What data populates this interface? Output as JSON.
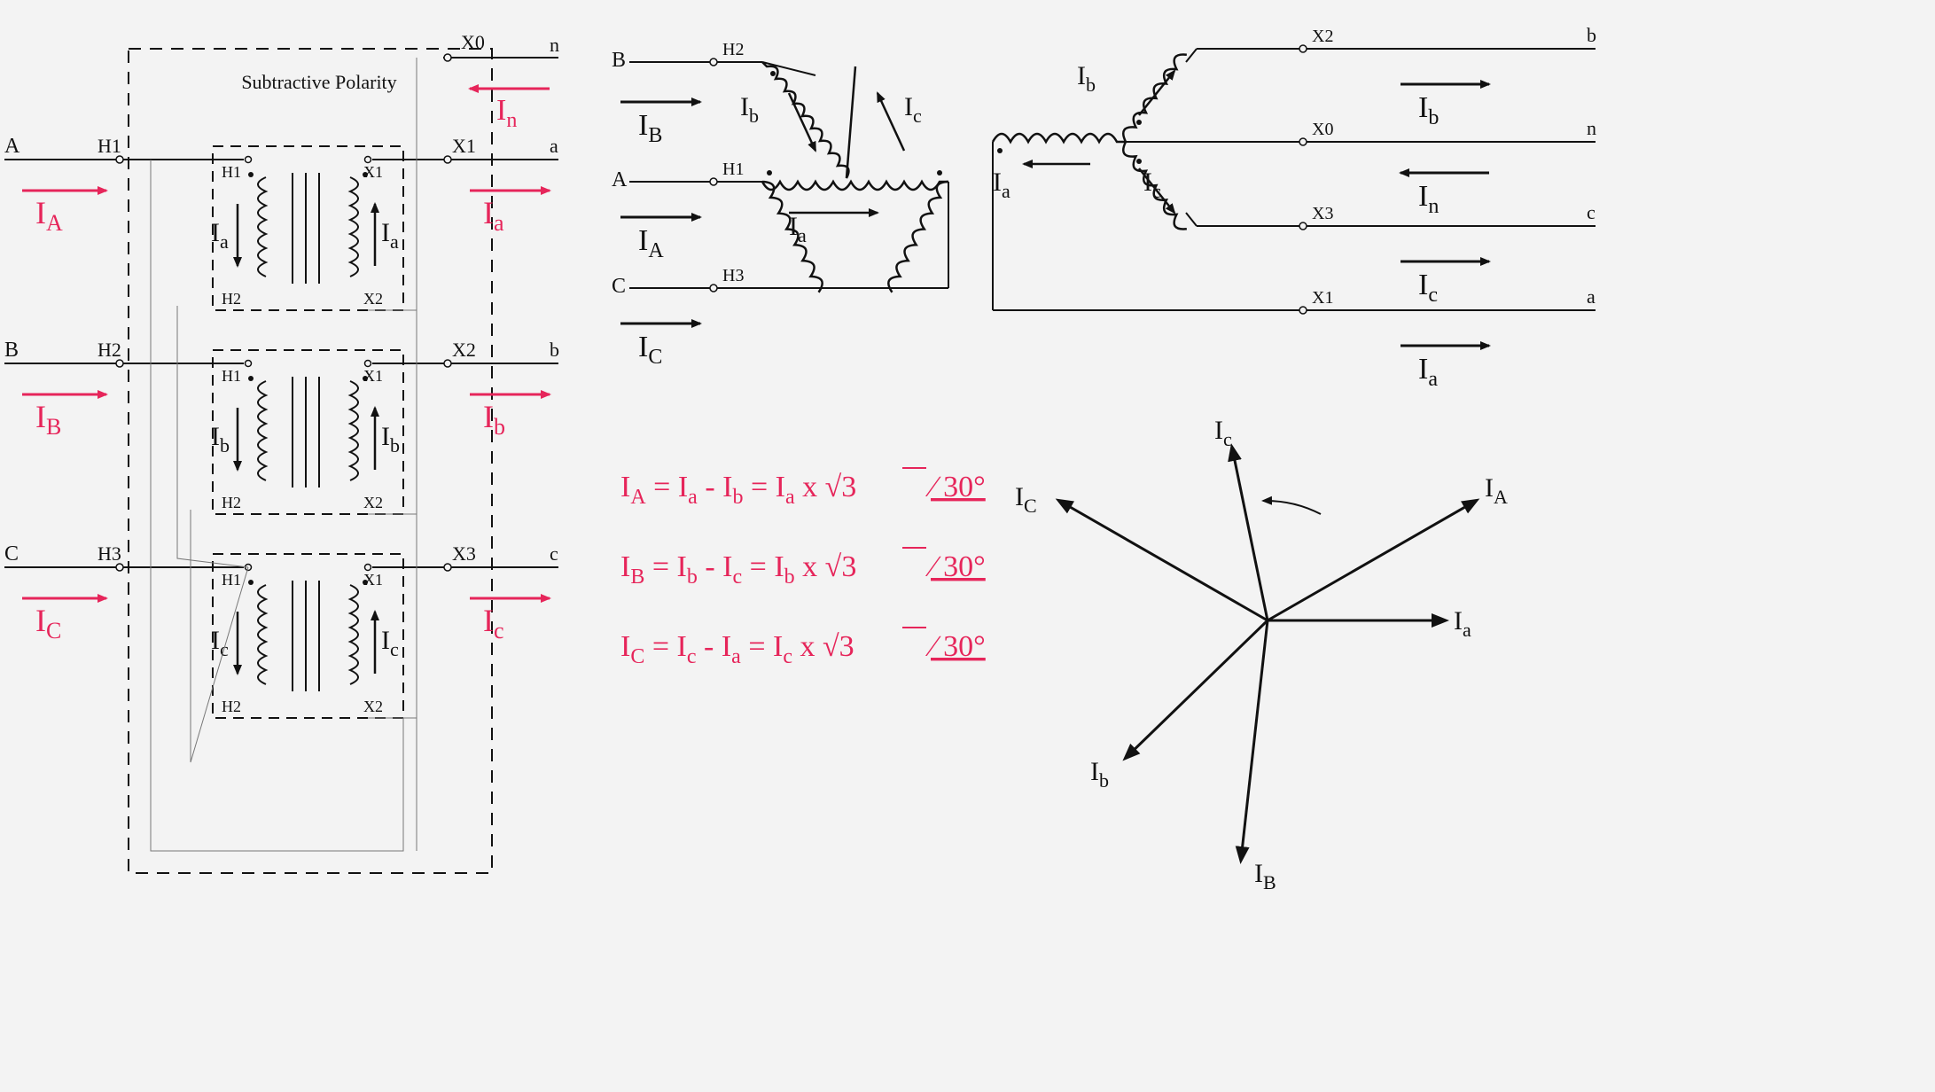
{
  "diagram_kind": "three_phase_transformer_delta_wye_current_diagram",
  "enclosure_note": "Subtractive Polarity",
  "left_panel": {
    "primaries": [
      {
        "phase_label": "A",
        "external_terminal": "H1",
        "internal_top": "H1",
        "internal_bottom": "H2",
        "current_red": "I_A",
        "coil_current": "I_a",
        "coil_arrow": "down"
      },
      {
        "phase_label": "B",
        "external_terminal": "H2",
        "internal_top": "H1",
        "internal_bottom": "H2",
        "current_red": "I_B",
        "coil_current": "I_b",
        "coil_arrow": "down"
      },
      {
        "phase_label": "C",
        "external_terminal": "H3",
        "internal_top": "H1",
        "internal_bottom": "H2",
        "current_red": "I_C",
        "coil_current": "I_c",
        "coil_arrow": "down"
      }
    ],
    "secondaries": [
      {
        "external_terminal": "X1",
        "line_label": "a",
        "internal_top": "X1",
        "internal_bottom": "X2",
        "current_red": "I_a",
        "coil_current": "I_a",
        "coil_arrow": "up"
      },
      {
        "external_terminal": "X2",
        "line_label": "b",
        "internal_top": "X1",
        "internal_bottom": "X2",
        "current_red": "I_b",
        "coil_current": "I_b",
        "coil_arrow": "up"
      },
      {
        "external_terminal": "X3",
        "line_label": "c",
        "internal_top": "X1",
        "internal_bottom": "X2",
        "current_red": "I_c",
        "coil_current": "I_c",
        "coil_arrow": "up"
      }
    ],
    "neutral": {
      "external_terminal": "X0",
      "line_label": "n",
      "current_red": "I_n",
      "arrow_dir": "left"
    }
  },
  "top_right_delta": {
    "inputs": [
      {
        "phase_label": "A",
        "terminal": "H1",
        "current": "I_A"
      },
      {
        "phase_label": "B",
        "terminal": "H2",
        "current": "I_B"
      },
      {
        "phase_label": "C",
        "terminal": "H3",
        "current": "I_C"
      }
    ],
    "delta_side_currents": [
      "I_a",
      "I_b",
      "I_c"
    ]
  },
  "top_right_wye": {
    "neutral": {
      "terminal": "X0",
      "line_label": "n",
      "current": "I_n"
    },
    "outputs": [
      {
        "terminal": "X1",
        "line_label": "a",
        "current": "I_a"
      },
      {
        "terminal": "X2",
        "line_label": "b",
        "current": "I_b"
      },
      {
        "terminal": "X3",
        "line_label": "c",
        "current": "I_c"
      }
    ],
    "coil_currents_at_star": [
      "I_a",
      "I_b",
      "I_c"
    ]
  },
  "equations": [
    "I_A = I_a - I_b = I_a × √3 ∠30°",
    "I_B = I_b - I_c = I_b × √3 ∠30°",
    "I_C = I_c - I_a = I_c × √3 ∠30°"
  ],
  "phasor_diagram": {
    "vectors": [
      "I_A",
      "I_B",
      "I_C",
      "I_a",
      "I_b",
      "I_c"
    ],
    "rotation_indicator": "ccw_arc_between_Ic_and_IA",
    "angle_between_line_and_phase": "30°"
  }
}
